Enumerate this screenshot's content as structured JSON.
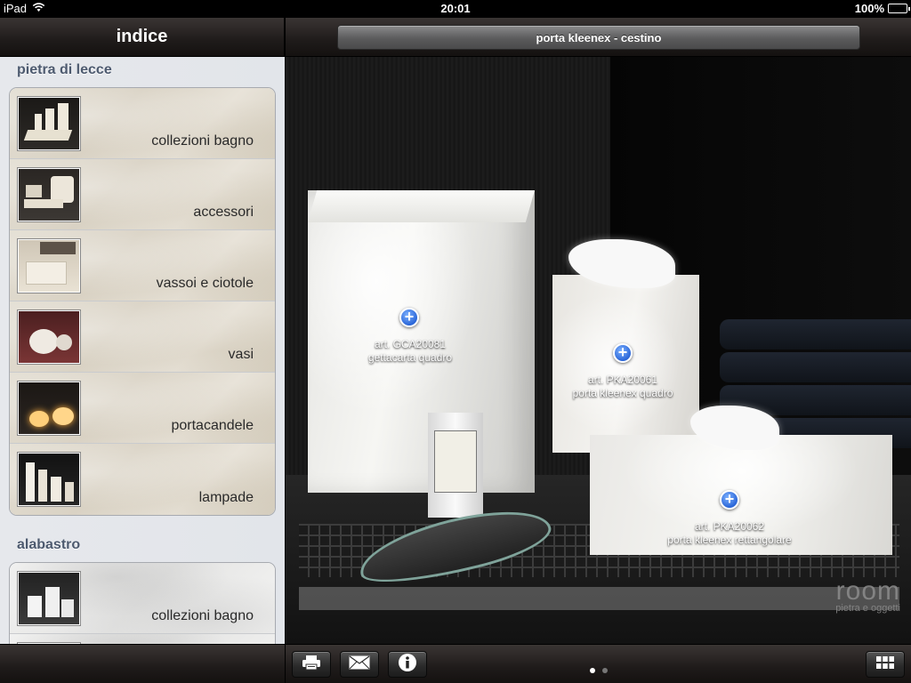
{
  "status_bar": {
    "carrier": "iPad",
    "time": "20:01",
    "battery": "100%",
    "battery_level": 1.0
  },
  "sidebar": {
    "title": "indice",
    "sections": [
      {
        "title": "pietra di lecce",
        "items": [
          {
            "label": "collezioni bagno"
          },
          {
            "label": "accessori"
          },
          {
            "label": "vassoi e ciotole"
          },
          {
            "label": "vasi"
          },
          {
            "label": "portacandele"
          },
          {
            "label": "lampade"
          }
        ]
      },
      {
        "title": "alabastro",
        "items": [
          {
            "label": "collezioni bagno"
          },
          {
            "label": ""
          }
        ]
      }
    ]
  },
  "main": {
    "title": "porta kleenex  - cestino",
    "products": [
      {
        "code": "art. GCA20081",
        "name": "gettacarta quadro"
      },
      {
        "code": "art. PKA20061",
        "name": "porta kleenex quadro"
      },
      {
        "code": "art. PKA20062",
        "name": "porta kleenex rettangolare"
      }
    ],
    "watermark": {
      "brand": "room",
      "tagline": "pietra e oggetti"
    },
    "page_indicator": {
      "count": 2,
      "current": 1
    }
  },
  "toolbar": {
    "icons": [
      "print-icon",
      "mail-icon",
      "info-icon",
      "grid-icon"
    ]
  },
  "colors": {
    "bar_dark": "#1f1b1a",
    "section_title": "#4d5a6f",
    "accent_blue": "#2a66d8"
  }
}
